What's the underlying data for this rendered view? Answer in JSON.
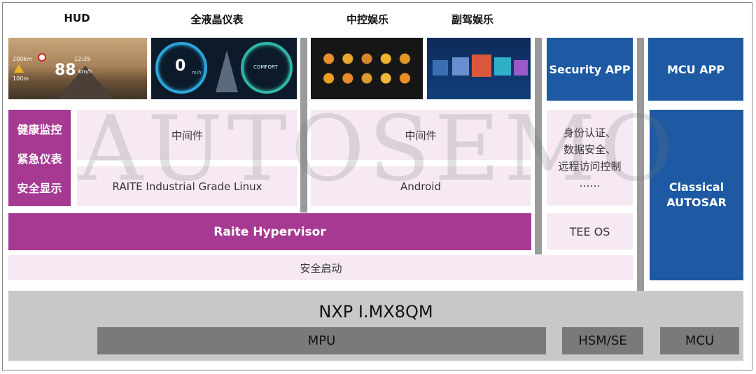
{
  "headers": {
    "hud": "HUD",
    "cluster": "全液晶仪表",
    "center": "中控娱乐",
    "passenger": "副驾娱乐"
  },
  "hud_screen": {
    "speed": "88",
    "unit": "km/h",
    "time": "12:35",
    "dist1": "200km",
    "dist2": "100m"
  },
  "cluster_screen": {
    "gauge_value": "0",
    "gauge_unit": "m/h",
    "mode": "COMFORT"
  },
  "left_labels": [
    "健康监控",
    "紧急仪表",
    "安全显示"
  ],
  "linux_middleware": "中间件",
  "linux_os": "RAITE Industrial Grade Linux",
  "android_middleware": "中间件",
  "android_os": "Android",
  "hypervisor": "Raite Hypervisor",
  "secure_boot": "安全启动",
  "security_app": "Security APP",
  "security_services": [
    "身份认证、",
    "数据安全、",
    "远程访问控制",
    "……"
  ],
  "tee_os": "TEE OS",
  "mcu_app": "MCU APP",
  "classical_autosar": [
    "Classical",
    "AUTOSAR"
  ],
  "soc": "NXP I.MX8QM",
  "mpu": "MPU",
  "hsm": "HSM/SE",
  "mcu": "MCU",
  "watermark": "AUTOSEMO",
  "colors": {
    "magenta": "#a63a93",
    "pink": "#f6e9f3",
    "blue": "#1d5aa3",
    "gray_light": "#c8c8c8",
    "gray_dark": "#7a7a7a"
  }
}
